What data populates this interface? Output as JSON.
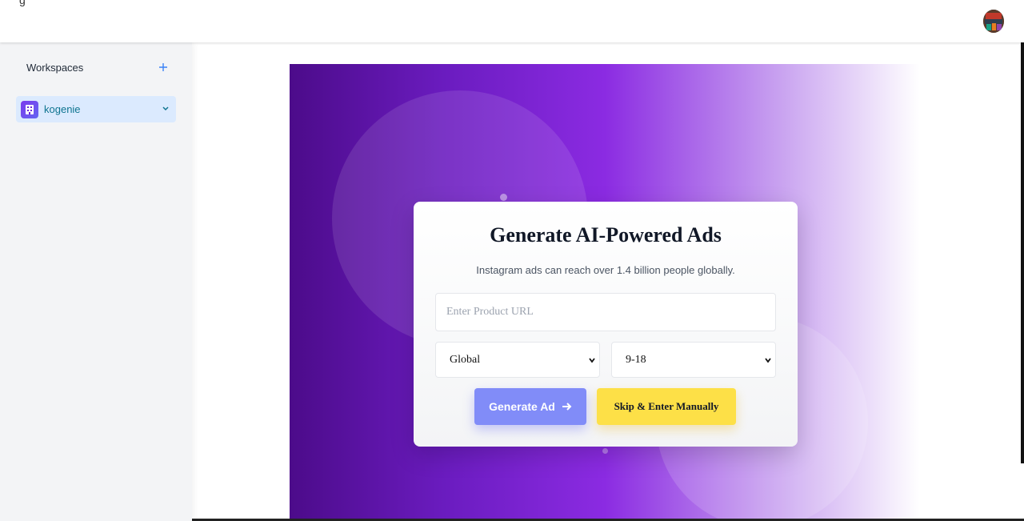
{
  "topbar": {
    "cut_text": "g"
  },
  "sidebar": {
    "title": "Workspaces",
    "add_icon": "plus-icon",
    "items": [
      {
        "label": "kogenie",
        "icon": "building-icon",
        "selected": true
      }
    ]
  },
  "hero": {
    "title": "Generate AI-Powered Ads",
    "subtitle": "Instagram ads can reach over 1.4 billion people globally.",
    "url_placeholder": "Enter Product URL",
    "url_value": "",
    "region_select": {
      "value": "Global"
    },
    "age_select": {
      "value": "9-18"
    },
    "generate_label": "Generate Ad",
    "skip_label": "Skip & Enter Manually"
  },
  "colors": {
    "accent_blue": "#3b82f6",
    "generate_button": "#818cf8",
    "skip_button": "#fde047",
    "hero_gradient_start": "#4c0b8a",
    "hero_gradient_mid": "#8b2be2",
    "selected_item_bg": "#dbeafe",
    "selected_item_text": "#0e7490"
  }
}
